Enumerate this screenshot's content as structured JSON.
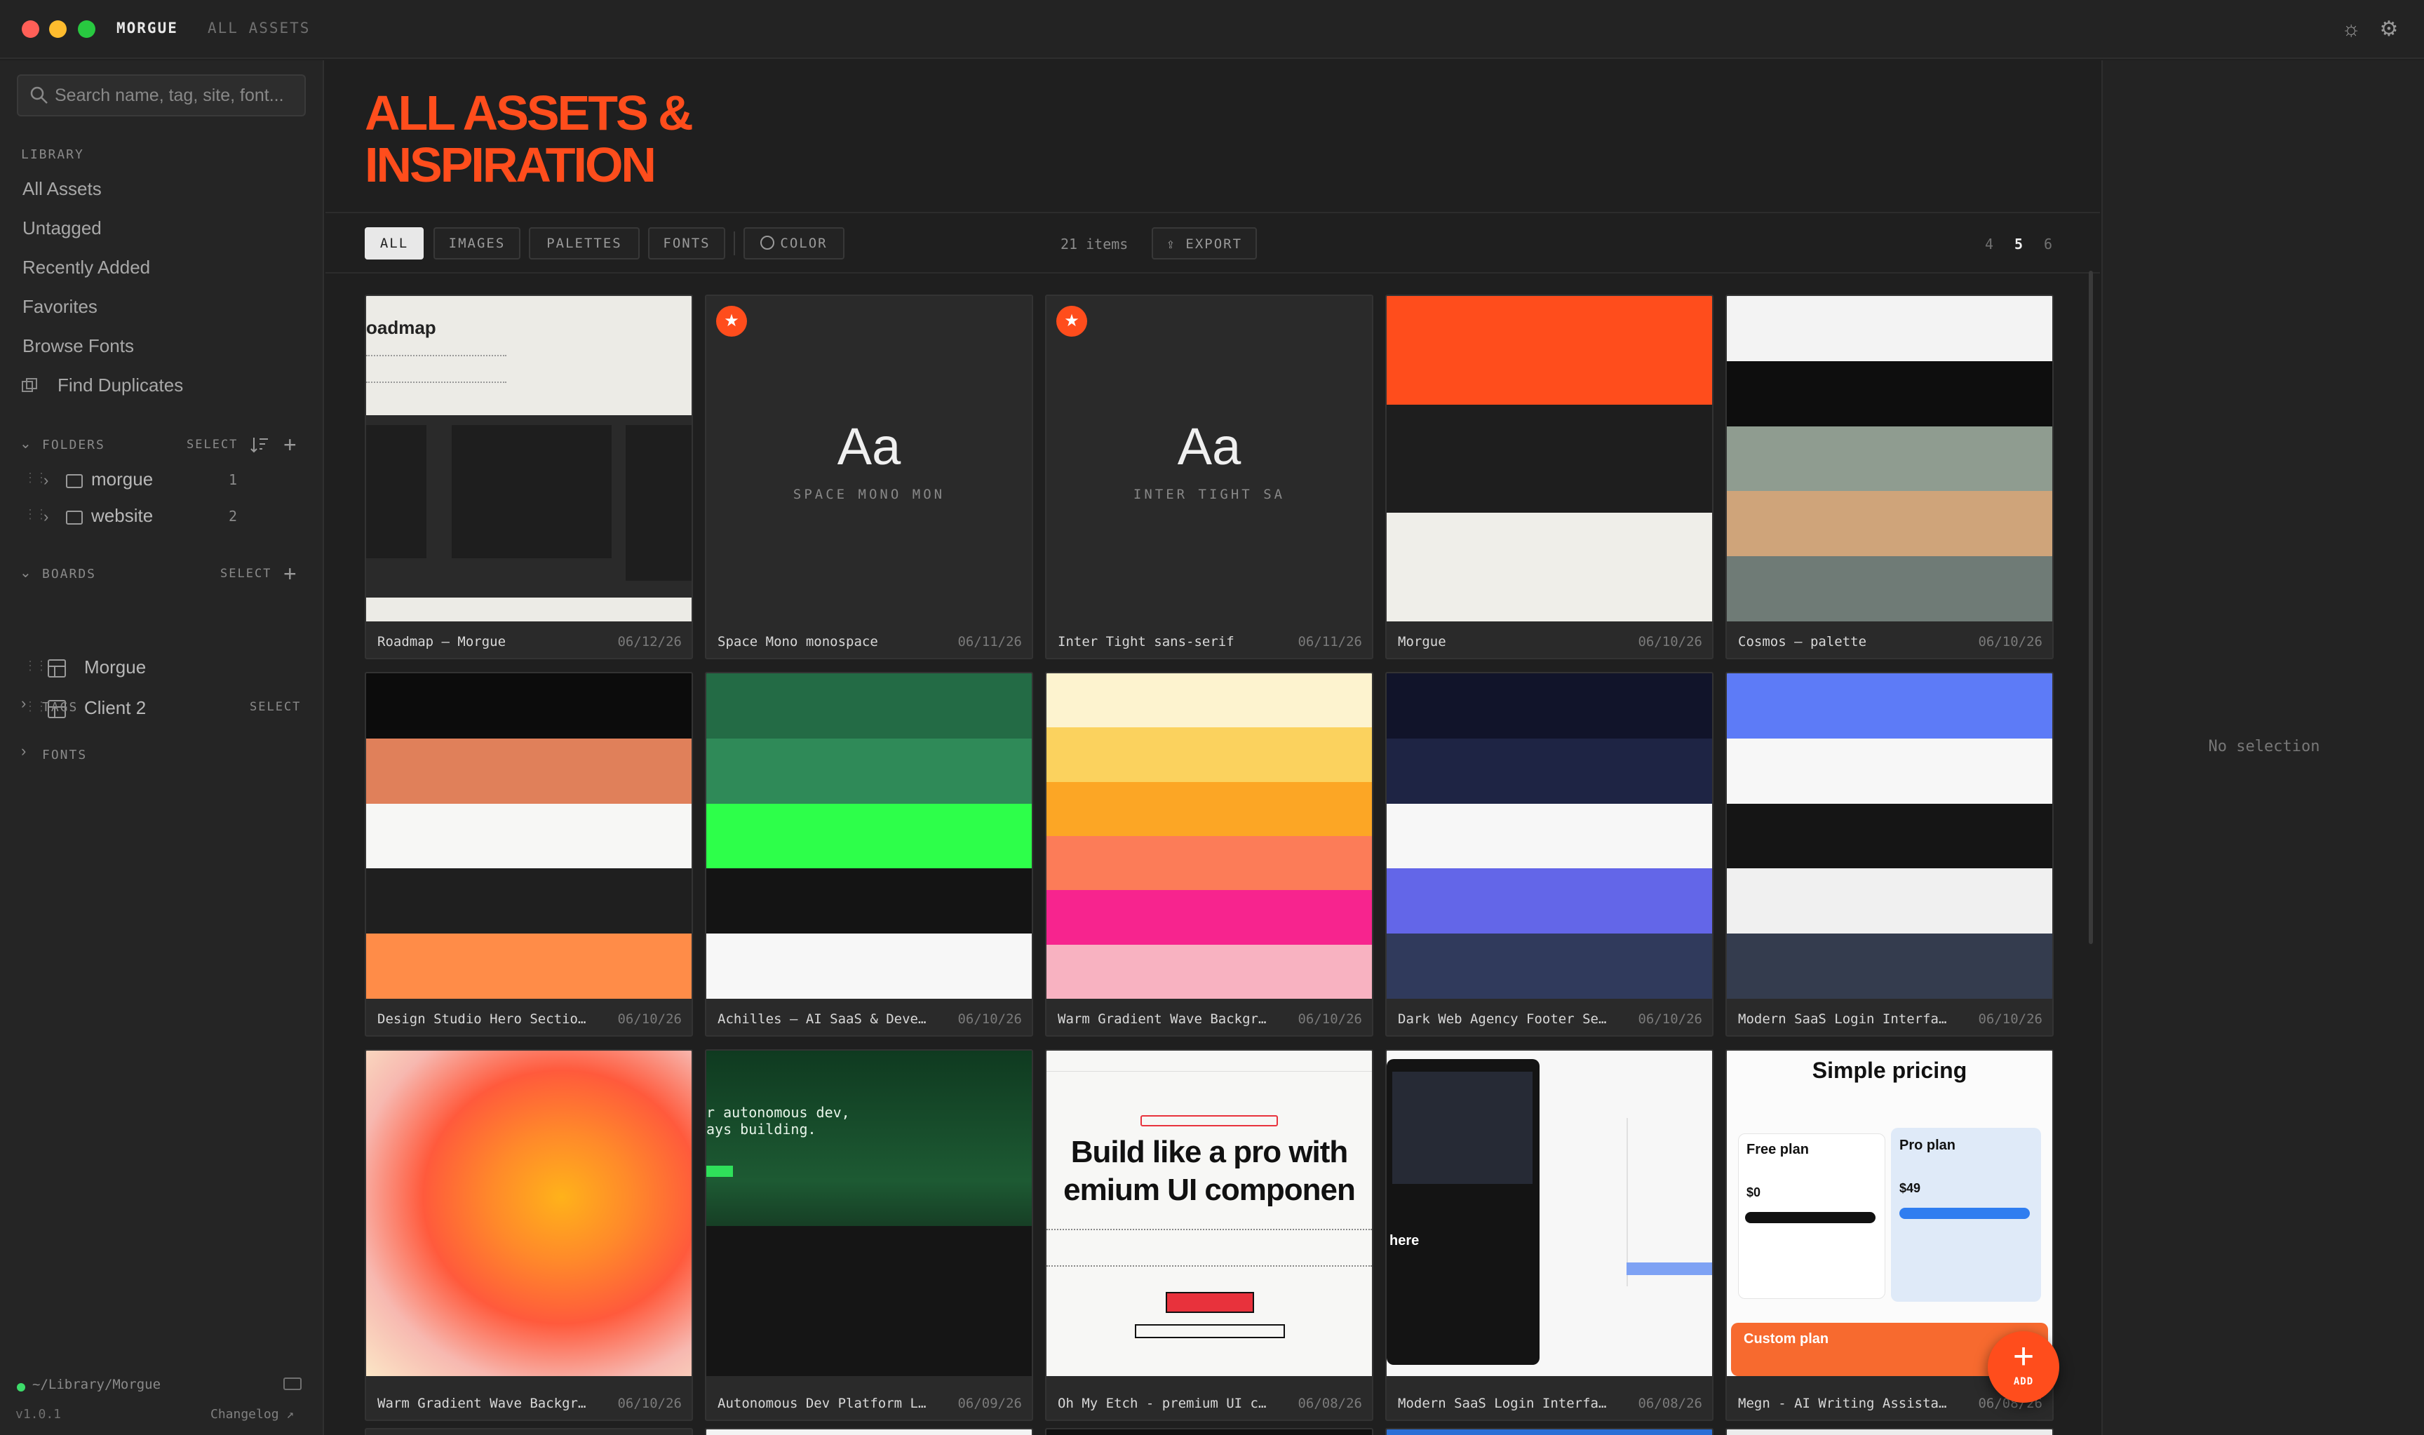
{
  "titlebar": {
    "app_name": "MORGUE",
    "breadcrumb": "ALL ASSETS"
  },
  "sidebar": {
    "search_placeholder": "Search name, tag, site, font...",
    "library_label": "LIBRARY",
    "library_items": [
      "All Assets",
      "Untagged",
      "Recently Added",
      "Favorites",
      "Browse Fonts",
      "Find Duplicates"
    ],
    "folders_label": "FOLDERS",
    "folders_select": "SELECT",
    "folders": [
      {
        "name": "morgue",
        "count": "1"
      },
      {
        "name": "website",
        "count": "2"
      }
    ],
    "boards_label": "BOARDS",
    "boards_select": "SELECT",
    "boards": [
      "Morgue",
      "Client 2"
    ],
    "tags_label": "TAGS",
    "tags_select": "SELECT",
    "fonts_label": "FONTS",
    "library_path": "~/Library/Morgue",
    "version": "v1.0.1",
    "changelog": "Changelog ↗"
  },
  "main": {
    "title": "ALL ASSETS & INSPIRATION",
    "filters": [
      "ALL",
      "IMAGES",
      "PALETTES",
      "FONTS",
      "COLOR"
    ],
    "item_count": "21 items",
    "export_label": "EXPORT",
    "column_options": [
      "4",
      "5",
      "6"
    ],
    "active_columns": "5"
  },
  "cards": [
    {
      "title": "Roadmap — Morgue",
      "date": "06/12/26",
      "kind": "screenshot-roadmap"
    },
    {
      "title": "Space Mono monospace",
      "date": "06/11/26",
      "kind": "font",
      "glyph": "Aa",
      "sample": "SPACE MONO MON",
      "favorite": true
    },
    {
      "title": "Inter Tight sans-serif",
      "date": "06/11/26",
      "kind": "font",
      "glyph": "Aa",
      "sample": "INTER TIGHT SA",
      "favorite": true
    },
    {
      "title": "Morgue",
      "date": "06/10/26",
      "kind": "palette",
      "colors": [
        "#ff4d1c",
        "#1e1e1e",
        "#efeee9"
      ]
    },
    {
      "title": "Cosmos — palette",
      "date": "06/10/26",
      "kind": "palette",
      "colors": [
        "#f3f3f3",
        "#0e0e0e",
        "#8f9c90",
        "#cfa47a",
        "#6f7b76"
      ]
    },
    {
      "title": "Design Studio Hero Section — Agency",
      "date": "06/10/26",
      "kind": "palette",
      "colors": [
        "#0c0c0c",
        "#e0805a",
        "#f7f7f5",
        "#1f1f1f",
        "#ff8c48"
      ]
    },
    {
      "title": "Achilles — AI SaaS & Developer Platform",
      "date": "06/10/26",
      "kind": "palette",
      "colors": [
        "#236b45",
        "#2f8a58",
        "#2dff4a",
        "#141414",
        "#f7f7f7"
      ]
    },
    {
      "title": "Warm Gradient Wave Background Palette",
      "date": "06/10/26",
      "kind": "palette",
      "colors": [
        "#fdf3cf",
        "#fbd25e",
        "#fca625",
        "#fc7c58",
        "#f7248e",
        "#f8b2c1"
      ]
    },
    {
      "title": "Dark Web Agency Footer Section",
      "date": "06/10/26",
      "kind": "palette",
      "colors": [
        "#11142a",
        "#1e2444",
        "#f7f7f7",
        "#6366e8",
        "#303a5c"
      ]
    },
    {
      "title": "Modern SaaS Login Interface — Palette",
      "date": "06/10/26",
      "kind": "palette",
      "colors": [
        "#5d7bf7",
        "#f7f7f7",
        "#151515",
        "#f0f0f0",
        "#343c4e"
      ]
    },
    {
      "title": "Warm Gradient Wave Background",
      "date": "06/10/26",
      "kind": "gradient"
    },
    {
      "title": "Autonomous Dev Platform Landing Page",
      "date": "06/09/26",
      "kind": "screenshot-dev",
      "lines": [
        "r autonomous dev,",
        "ays building."
      ]
    },
    {
      "title": "Oh My Etch - premium UI components",
      "date": "06/08/26",
      "kind": "screenshot-etch",
      "headline1": "Build like a pro with",
      "headline2": "emium UI componen"
    },
    {
      "title": "Modern SaaS Login Interface",
      "date": "06/08/26",
      "kind": "screenshot-login",
      "word": "here"
    },
    {
      "title": "Megn - AI Writing Assistant Pricing",
      "date": "06/08/26",
      "kind": "screenshot-pricing",
      "heading": "Simple pricing",
      "free": "Free plan",
      "pro": "Pro plan",
      "custom": "Custom plan",
      "free_price": "$0",
      "pro_price": "$49"
    }
  ],
  "inspector": {
    "empty": "No selection"
  },
  "fab": {
    "label": "ADD"
  },
  "colors": {
    "accent": "#ff4d1c",
    "bg": "#1f1f1f",
    "sidebar": "#252525"
  }
}
